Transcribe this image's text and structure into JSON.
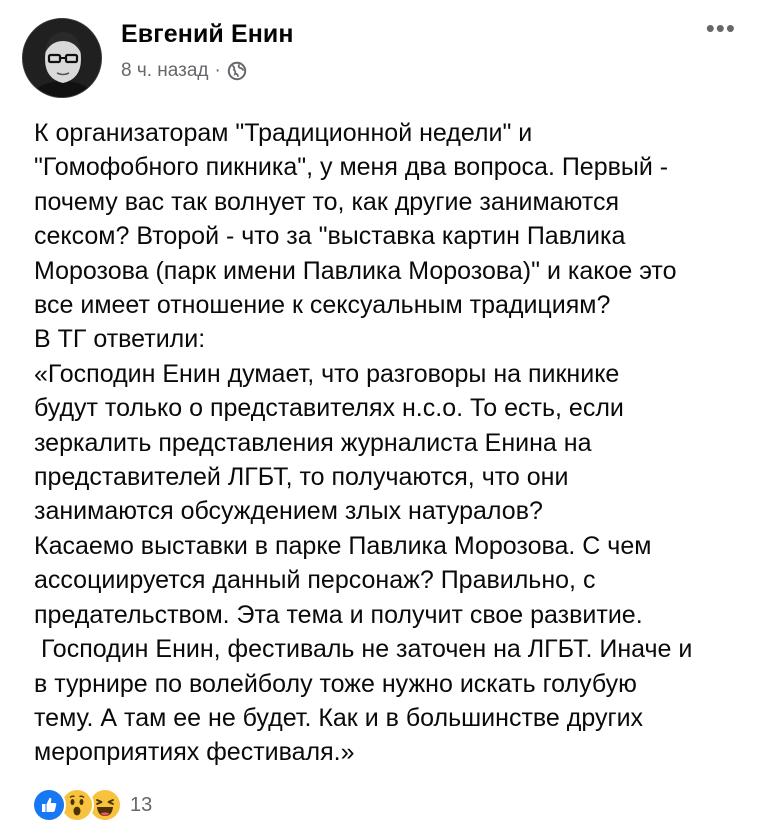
{
  "post": {
    "author": "Евгений Енин",
    "time": "8 ч. назад",
    "separator": "·",
    "more_label": "•••",
    "text_lines": [
      "К организаторам \"Традиционной недели\" и",
      "\"Гомофобного пикника\", у меня два вопроса. Первый -",
      "почему вас так волнует то, как другие занимаются",
      "сексом? Второй - что за \"выставка картин Павлика",
      "Морозова (парк имени Павлика Морозова)\" и какое это",
      "все имеет отношение к сексуальным традициям?",
      "В ТГ ответили:",
      "«Господин Енин думает, что разговоры на пикнике",
      "будут только о представителях н.с.о. То есть, если",
      "зеркалить представления журналиста Енина на",
      "представителей ЛГБТ, то получаются, что они",
      "занимаются обсуждением злых натуралов?",
      "Касаемо выставки в парке Павлика Морозова. С чем",
      "ассоциируется данный персонаж? Правильно, с",
      "предательством. Эта тема и получит свое развитие.",
      " Господин Енин, фестиваль не заточен на ЛГБТ. Иначе и",
      "в турнире по волейболу тоже нужно искать голубую",
      "тему. А там ее не будет. Как и в большинстве других",
      "мероприятиях фестиваля.»"
    ],
    "reactions": {
      "icons": [
        "like-icon",
        "wow-icon",
        "haha-icon"
      ],
      "count": "13"
    }
  },
  "colors": {
    "text": "#050505",
    "meta": "#65676b",
    "like_blue": "#1877f2",
    "emoji_yellow": "#f7c33f"
  }
}
